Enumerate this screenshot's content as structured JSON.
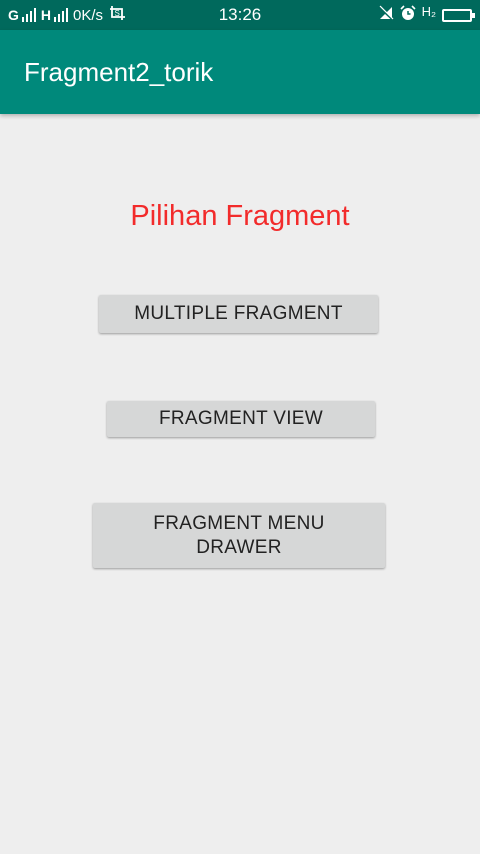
{
  "status_bar": {
    "signal1_label": "G",
    "signal2_label": "H",
    "net_speed": "0K/s",
    "screenshot_icon": "screenshot-icon",
    "time": "13:26",
    "mute_icon": "vibrate-off-icon",
    "alarm_icon": "alarm-icon",
    "h2_label": "H₂",
    "battery_icon": "battery-icon"
  },
  "app_bar": {
    "title": "Fragment2_torik"
  },
  "main": {
    "heading": "Pilihan Fragment",
    "buttons": [
      {
        "label": "MULTIPLE FRAGMENT"
      },
      {
        "label": "FRAGMENT VIEW"
      },
      {
        "label": "FRAGMENT MENU\nDRAWER"
      }
    ]
  },
  "colors": {
    "status_bar": "#00695c",
    "app_bar": "#00897b",
    "heading": "#f22b2b",
    "button": "#d6d7d7",
    "background": "#eeeeee"
  }
}
